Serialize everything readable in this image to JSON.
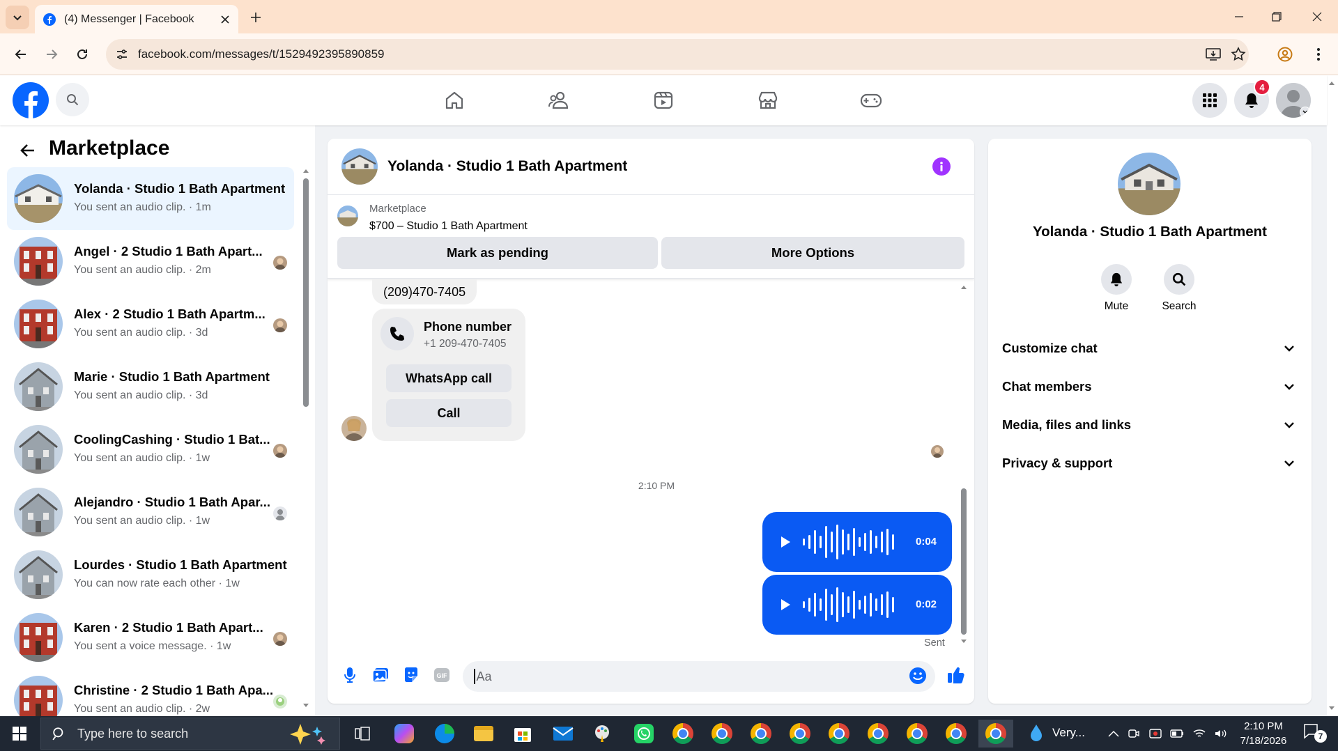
{
  "browser": {
    "tab_title": "(4) Messenger | Facebook",
    "url": "facebook.com/messages/t/1529492395890859"
  },
  "fb_header": {
    "notification_count": "4"
  },
  "sidebar": {
    "title": "Marketplace",
    "conversations": [
      {
        "name": "Yolanda · Studio 1 Bath Apartment",
        "preview": "You sent an audio clip. · 1m",
        "active": true
      },
      {
        "name": "Angel · 2 Studio 1 Bath Apart...",
        "preview": "You sent an audio clip. · 2m"
      },
      {
        "name": "Alex · 2 Studio 1 Bath Apartm...",
        "preview": "You sent an audio clip. · 3d"
      },
      {
        "name": "Marie · Studio 1 Bath Apartment",
        "preview": "You sent an audio clip. · 3d"
      },
      {
        "name": "CoolingCashing · Studio 1 Bat...",
        "preview": "You sent an audio clip. · 1w"
      },
      {
        "name": "Alejandro · Studio 1 Bath Apar...",
        "preview": "You sent an audio clip. · 1w"
      },
      {
        "name": "Lourdes · Studio 1 Bath Apartment",
        "preview": "You can now rate each other · 1w"
      },
      {
        "name": "Karen · 2 Studio 1 Bath Apart...",
        "preview": "You sent a voice message. · 1w"
      },
      {
        "name": "Christine · 2 Studio 1 Bath Apa...",
        "preview": "You sent an audio clip. · 2w"
      }
    ]
  },
  "chat": {
    "title": "Yolanda · Studio 1 Bath Apartment",
    "listing_label": "Marketplace",
    "listing_price_title": "$700 – Studio 1 Bath Apartment",
    "mark_pending": "Mark as pending",
    "more_options": "More Options",
    "phone_bubble": "(209)470-7405",
    "phone_card_title": "Phone number",
    "phone_card_number": "+1 209-470-7405",
    "whatsapp_call": "WhatsApp call",
    "call": "Call",
    "timestamp": "2:10 PM",
    "audio_clips": [
      {
        "duration": "0:04"
      },
      {
        "duration": "0:02"
      }
    ],
    "sent_label": "Sent",
    "composer_placeholder": "Aa"
  },
  "details": {
    "name": "Yolanda · Studio 1 Bath Apartment",
    "mute": "Mute",
    "search": "Search",
    "sections": [
      "Customize chat",
      "Chat members",
      "Media, files and links",
      "Privacy & support"
    ]
  },
  "taskbar": {
    "search_placeholder": "Type here to search",
    "weather": "Very...",
    "time": "2:10 PM",
    "date": "7/18/2026",
    "notif_count": "7"
  },
  "colors": {
    "fb_blue": "#0866ff",
    "messenger_blue": "#0a5af3",
    "info_purple": "#a033ff",
    "badge_red": "#e41e3f"
  }
}
